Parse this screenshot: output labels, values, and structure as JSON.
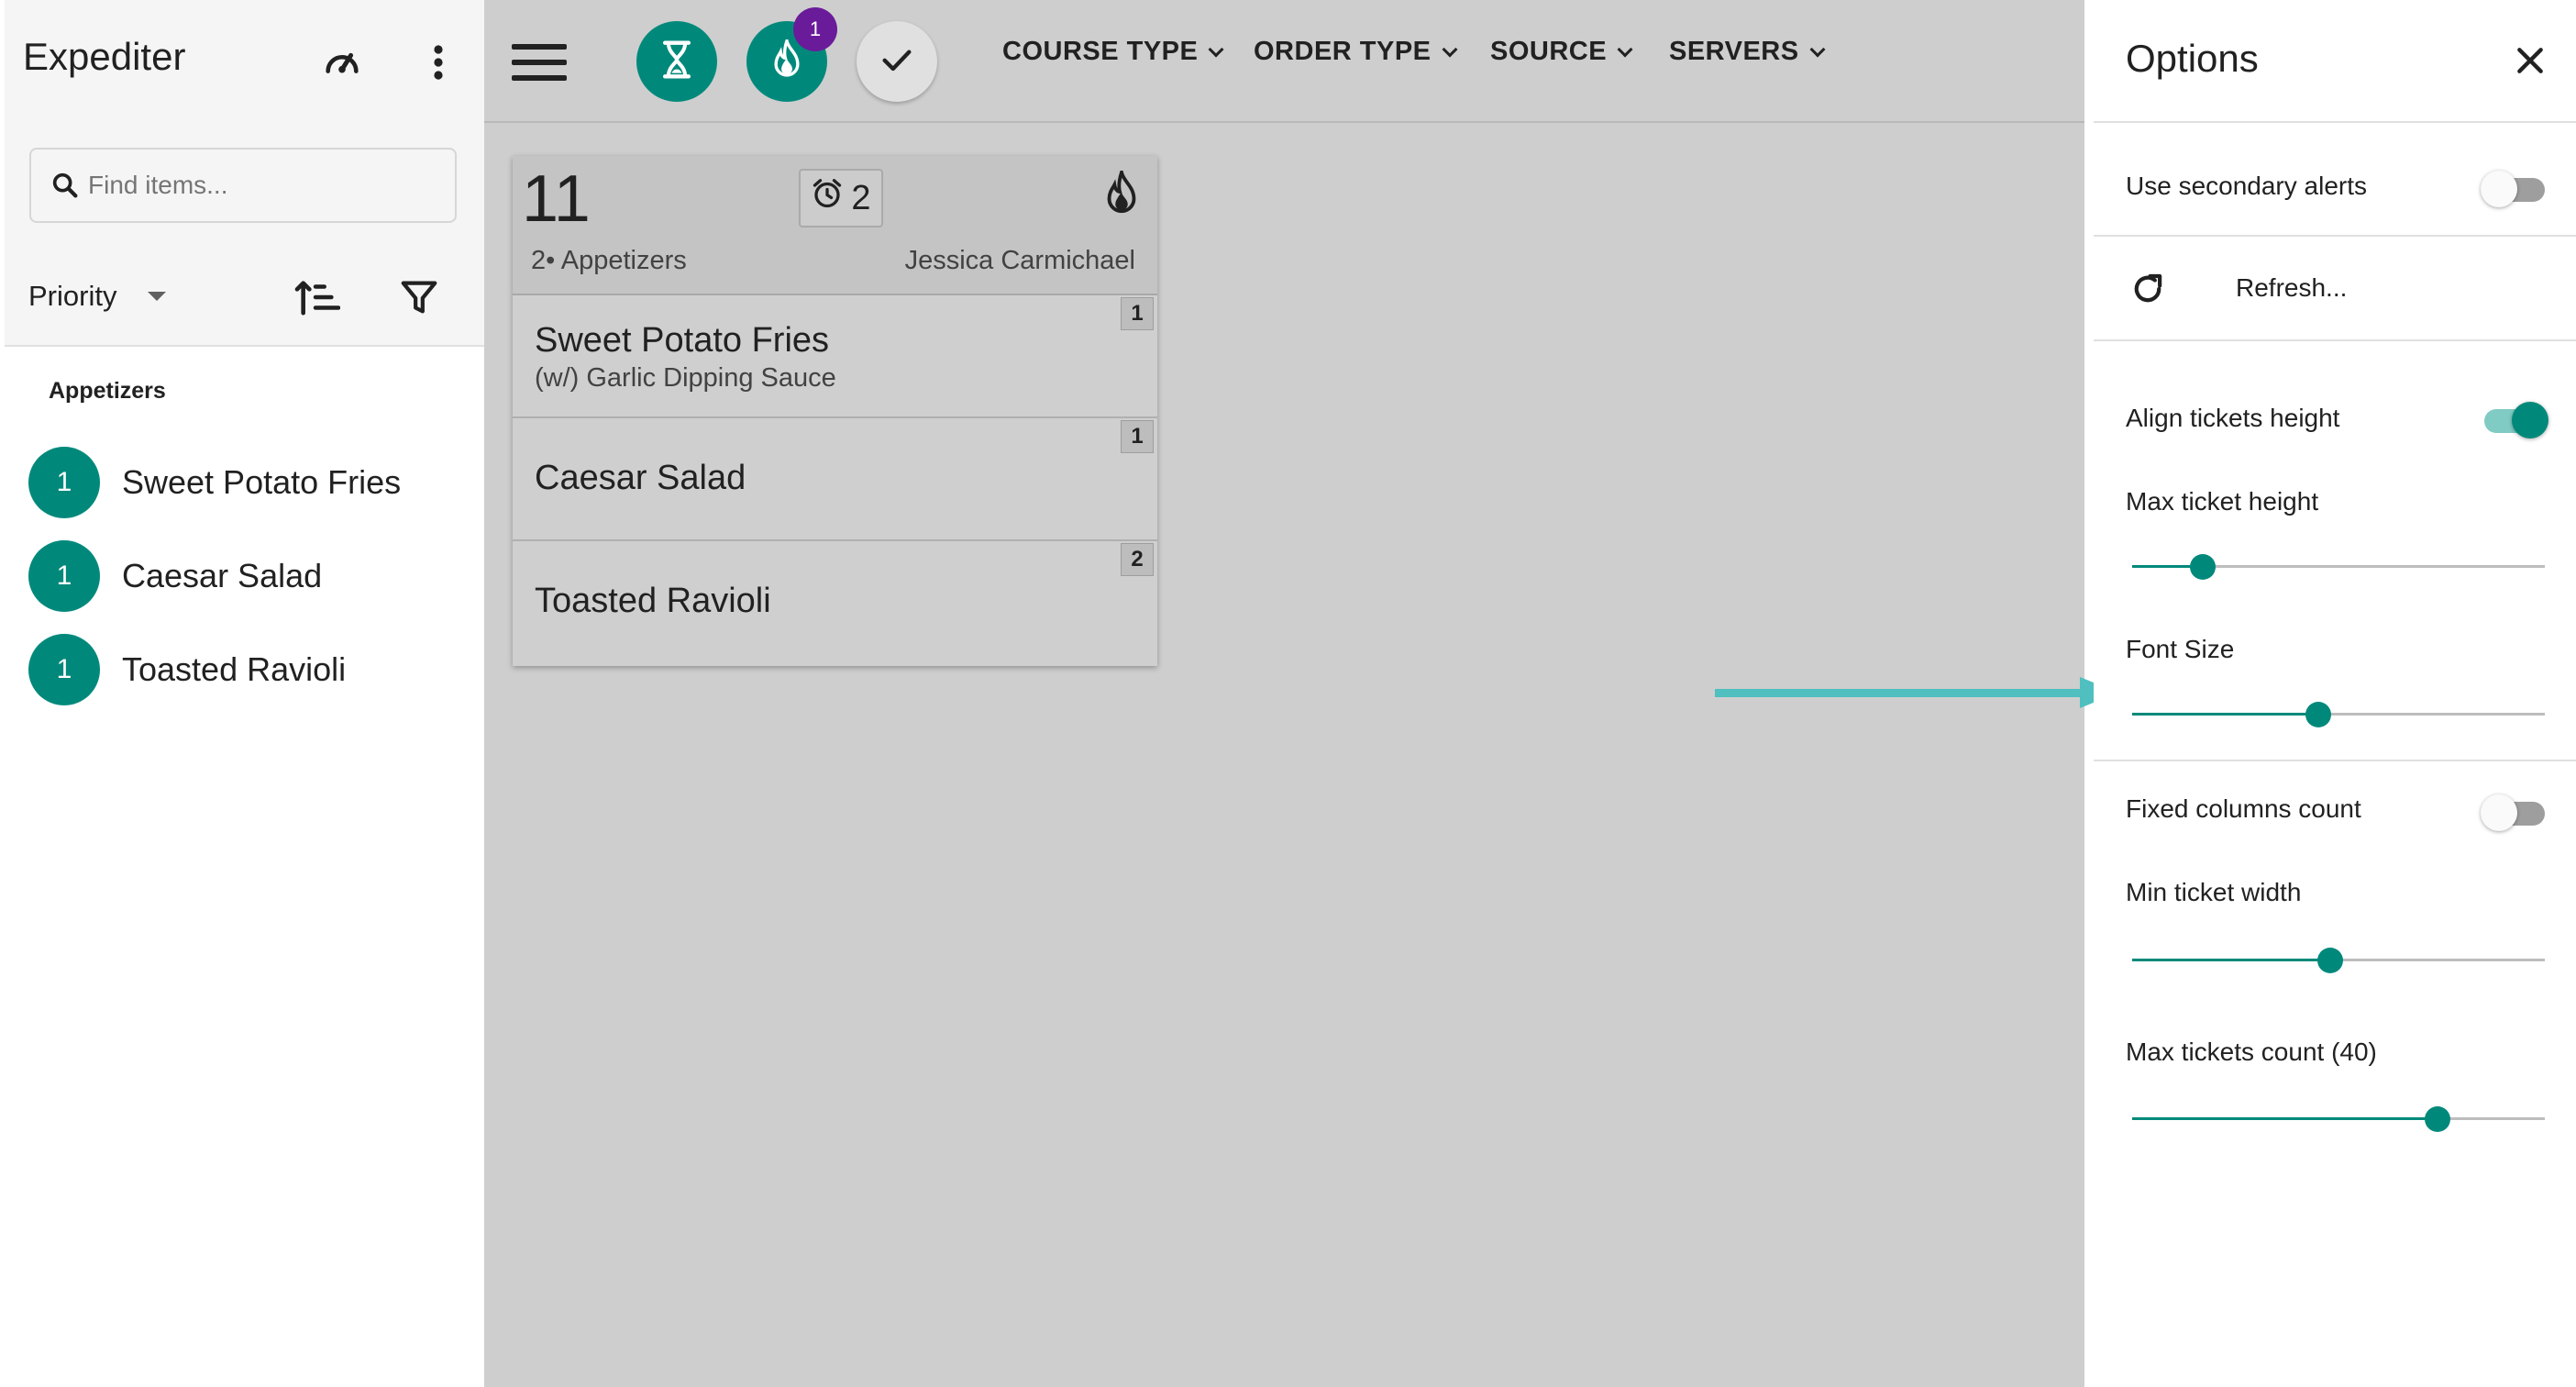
{
  "sidebar": {
    "title": "Expediter",
    "search": {
      "placeholder": "Find items...",
      "value": ""
    },
    "sort_select": {
      "value": "Priority"
    },
    "group_label": "Appetizers",
    "items": [
      {
        "count": "1",
        "name": "Sweet Potato Fries"
      },
      {
        "count": "1",
        "name": "Caesar Salad"
      },
      {
        "count": "1",
        "name": "Toasted Ravioli"
      }
    ]
  },
  "toolbar": {
    "fire_badge": "1",
    "filters": [
      "COURSE TYPE",
      "ORDER TYPE",
      "SOURCE",
      "SERVERS"
    ]
  },
  "ticket": {
    "number": "11",
    "timer_count": "2",
    "course": "2• Appetizers",
    "server": "Jessica Carmichael",
    "items": [
      {
        "name": "Sweet Potato Fries",
        "modifier": "(w/) Garlic Dipping Sauce",
        "qty": "1"
      },
      {
        "name": "Caesar Salad",
        "modifier": "",
        "qty": "1"
      },
      {
        "name": "Toasted Ravioli",
        "modifier": "",
        "qty": "2"
      }
    ]
  },
  "options": {
    "title": "Options",
    "secondary_alerts": {
      "label": "Use secondary alerts",
      "on": false
    },
    "refresh_label": "Refresh...",
    "align_height": {
      "label": "Align tickets height",
      "on": true
    },
    "max_ticket_height": {
      "label": "Max ticket height",
      "value": 0.17
    },
    "font_size": {
      "label": "Font Size",
      "value": 0.45
    },
    "fixed_columns": {
      "label": "Fixed columns count",
      "on": false
    },
    "min_ticket_width": {
      "label": "Min ticket width",
      "value": 0.48
    },
    "max_tickets_count": {
      "label": "Max tickets count (40)",
      "value": 0.74
    }
  },
  "colors": {
    "accent": "#00897b",
    "badge": "#6a1b9a",
    "annotation_arrow": "#4fbfbf"
  },
  "icons": [
    "speedometer-icon",
    "more-vert-icon",
    "search-icon",
    "sort-icon",
    "filter-icon",
    "menu-icon",
    "hourglass-icon",
    "fire-icon",
    "check-icon",
    "alarm-icon",
    "close-icon",
    "refresh-icon"
  ]
}
